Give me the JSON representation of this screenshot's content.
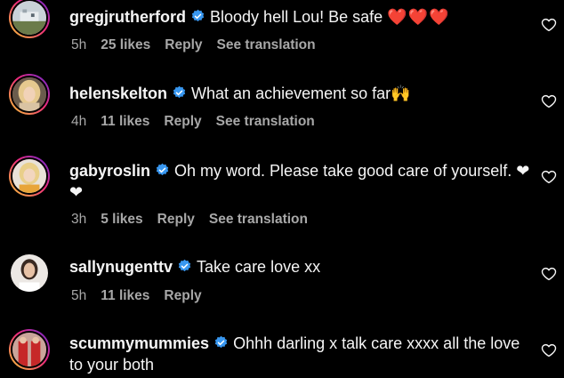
{
  "comments": [
    {
      "username": "gregjrutherford",
      "text": "Bloody hell Lou! Be safe ",
      "emoji": "❤️❤️❤️",
      "time": "5h",
      "likes": "25 likes",
      "reply": "Reply",
      "translation": "See translation"
    },
    {
      "username": "helenskelton",
      "text": "What an achievement so far",
      "emoji": "🙌",
      "time": "4h",
      "likes": "11 likes",
      "reply": "Reply",
      "translation": "See translation"
    },
    {
      "username": "gabyroslin",
      "text": "Oh my word. Please take good care of yourself. ",
      "emoji": "❤❤",
      "time": "3h",
      "likes": "5 likes",
      "reply": "Reply",
      "translation": "See translation"
    },
    {
      "username": "sallynugenttv",
      "text": "Take care love xx",
      "time": "5h",
      "likes": "11 likes",
      "reply": "Reply"
    },
    {
      "username": "scummymummies",
      "text": "Ohhh darling x talk care xxxx all the love to your both"
    }
  ],
  "colors": {
    "background": "#000000",
    "text": "#f5f5f5",
    "meta": "#a8a8a8",
    "verified": "#3897f0"
  },
  "icons": {
    "like": "heart-outline-icon",
    "verified": "verified-badge-icon"
  }
}
